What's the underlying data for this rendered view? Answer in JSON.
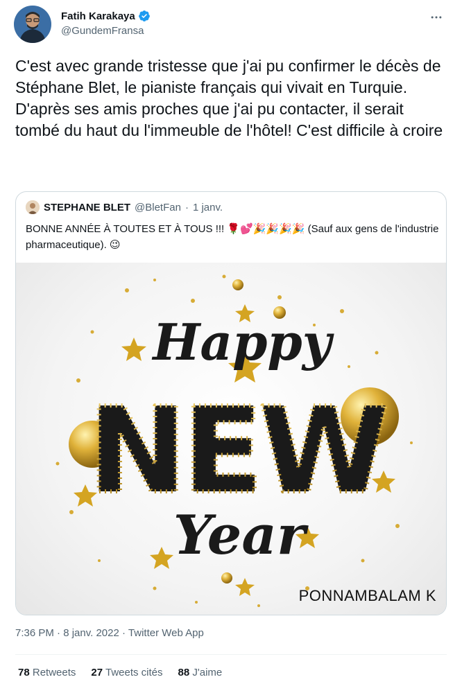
{
  "author": {
    "name": "Fatih Karakaya",
    "handle": "@GundemFransa",
    "verified": true
  },
  "tweet": {
    "paragraphs": [
      "C'est avec grande tristesse que j'ai pu confirmer le décès de Stéphane Blet, le pianiste français qui vivait en Turquie.",
      "D'après ses amis proches que j'ai pu contacter, il serait tombé du haut du l'immeuble de l'hôtel! C'est difficile à croire"
    ]
  },
  "quote": {
    "name": "STEPHANE BLET",
    "handle": "@BletFan",
    "separator": "·",
    "date": "1 janv.",
    "text_before": "BONNE ANNÉE À TOUTES ET À TOUS !!! ",
    "emojis": "🌹💕🎉🎉🎉🎉",
    "text_after": " (Sauf aux gens de l'industrie pharmaceutique). ",
    "trailing_emoji": "😉",
    "image": {
      "line1": "Happy",
      "line2": "NEW",
      "line3": "Year",
      "watermark": "PONNAMBALAM K",
      "gold_color": "#d4a422",
      "dark_color": "#1a1a1a"
    }
  },
  "meta": {
    "time": "7:36 PM",
    "sep1": " · ",
    "date": "8 janv. 2022",
    "sep2": " · ",
    "source": "Twitter Web App"
  },
  "stats": {
    "retweets_count": "78",
    "retweets_label": "Retweets",
    "quotes_count": "27",
    "quotes_label": "Tweets cités",
    "likes_count": "88",
    "likes_label": "J'aime"
  },
  "colors": {
    "text": "#0f1419",
    "secondary": "#536471",
    "verified": "#1d9bf0",
    "border": "#cfd9de"
  },
  "icons": {
    "verified": "verified-badge-icon",
    "more": "more-options-icon"
  }
}
